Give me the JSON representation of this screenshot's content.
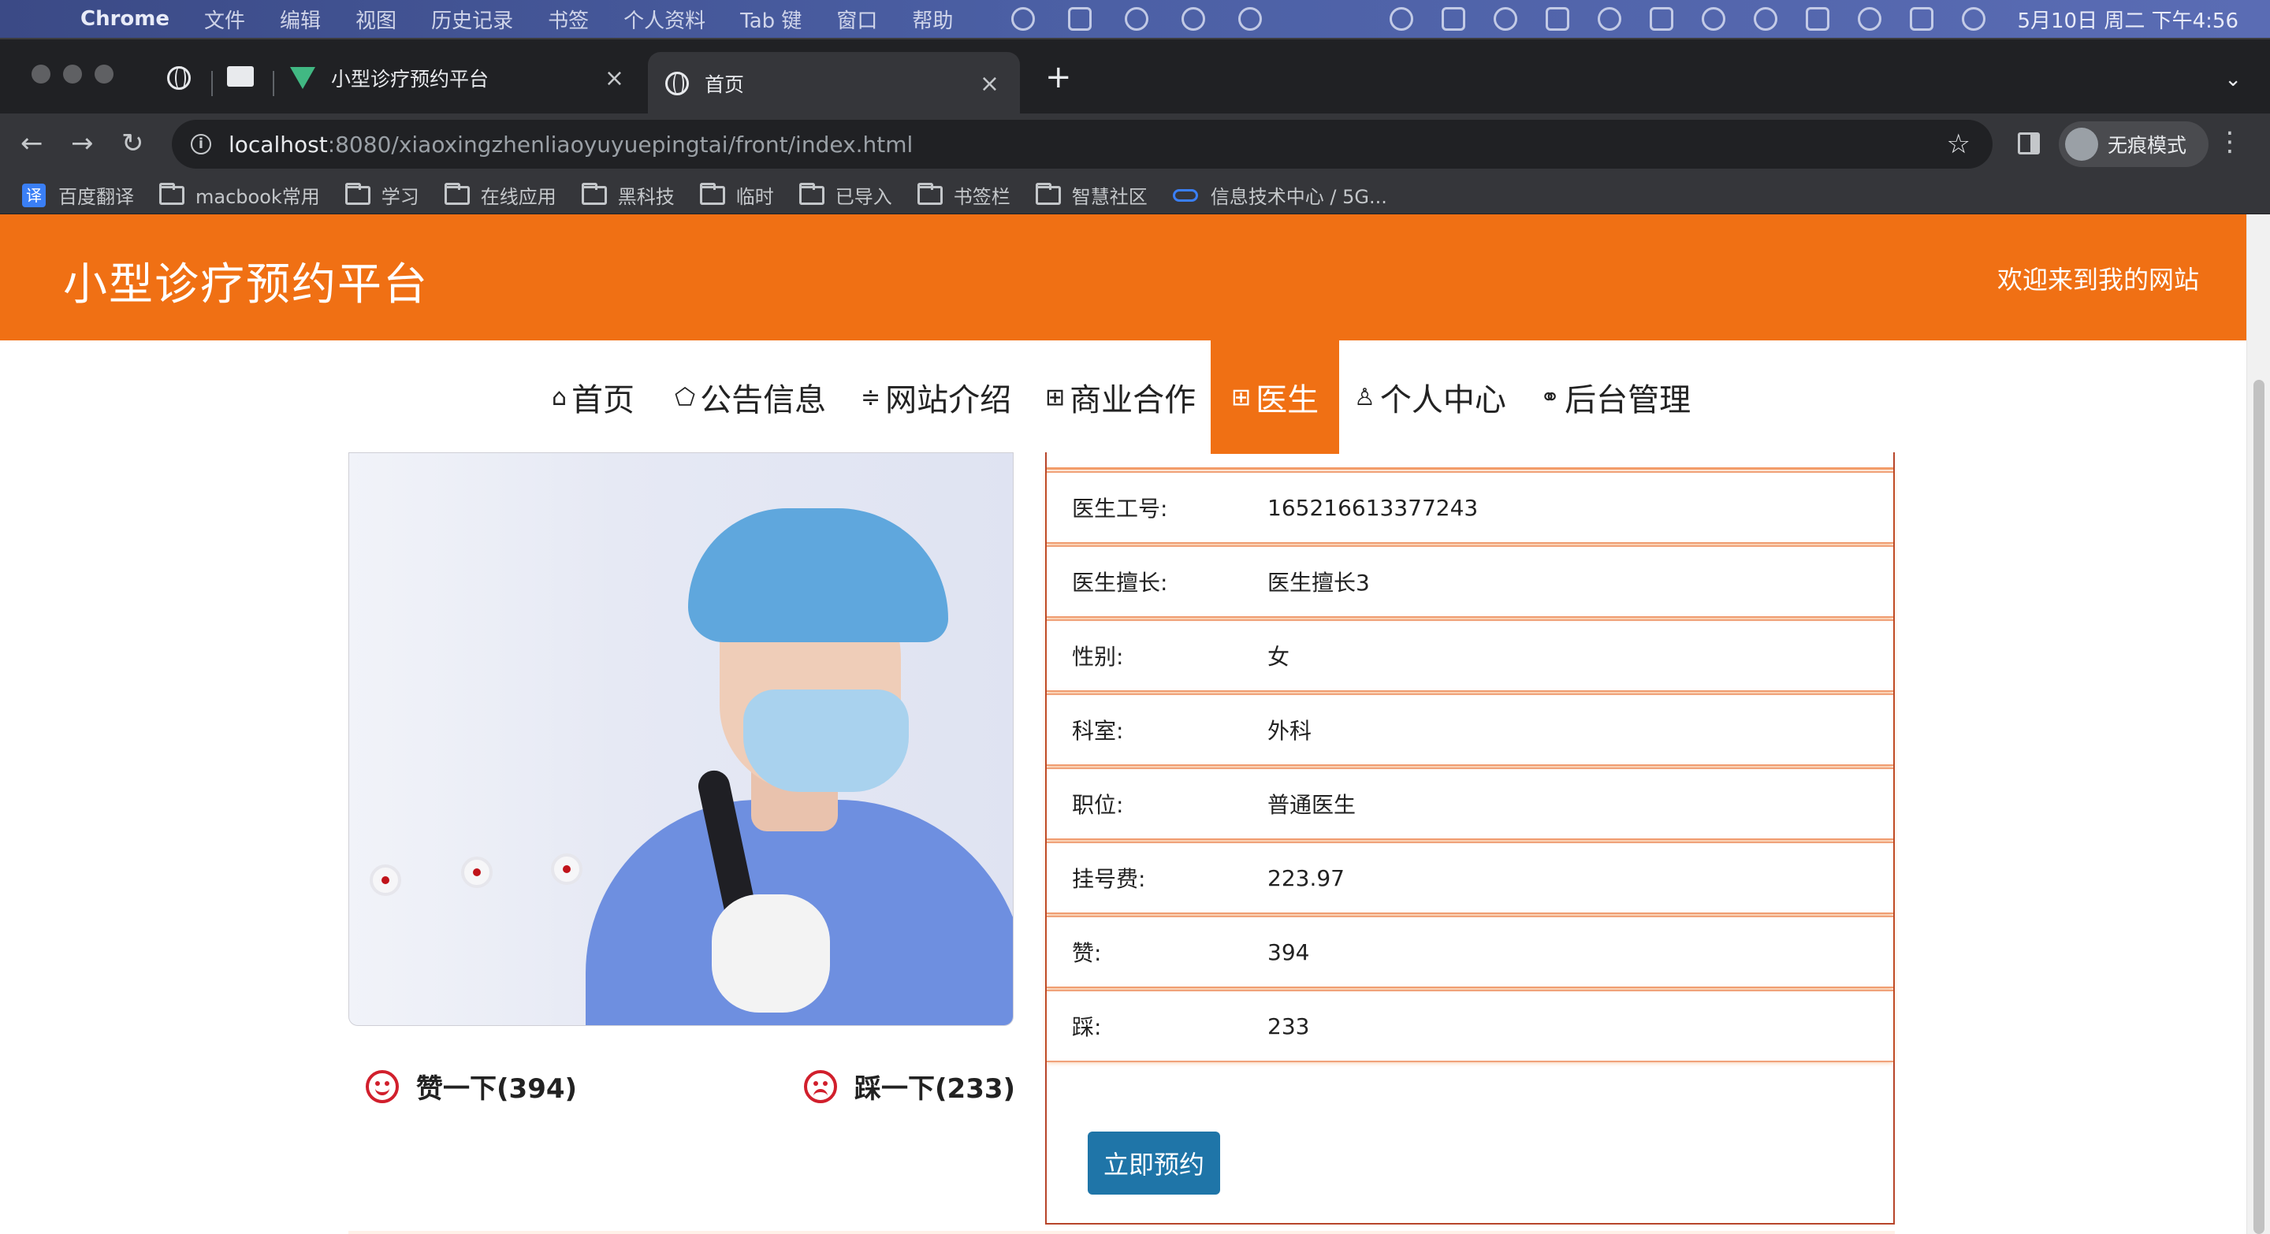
{
  "menubar": {
    "apple": "",
    "items": [
      "Chrome",
      "文件",
      "编辑",
      "视图",
      "历史记录",
      "书签",
      "个人资料",
      "Tab 键",
      "窗口",
      "帮助"
    ],
    "clock": "5月10日 周二 下午4:56"
  },
  "browser": {
    "tabs": [
      {
        "title": "小型诊疗预约平台",
        "icon": "vue-icon"
      },
      {
        "title": "首页",
        "icon": "globe-icon"
      }
    ],
    "close_glyph": "×",
    "new_tab_glyph": "+",
    "url_host": "localhost",
    "url_rest": ":8080/xiaoxingzhenliaoyuyuepingtai/front/index.html",
    "profile_label": "无痕模式",
    "bookmarks": [
      "百度翻译",
      "macbook常用",
      "学习",
      "在线应用",
      "黑科技",
      "临时",
      "已导入",
      "书签栏",
      "智慧社区",
      "信息技术中心 / 5G..."
    ],
    "translate_badge": "译"
  },
  "site": {
    "title": "小型诊疗预约平台",
    "welcome": "欢迎来到我的网站",
    "nav": [
      {
        "label": "首页",
        "icon": "⌂"
      },
      {
        "label": "公告信息",
        "icon": "⬠"
      },
      {
        "label": "网站介绍",
        "icon": "≑"
      },
      {
        "label": "商业合作",
        "icon": "⊞"
      },
      {
        "label": "医生",
        "icon": "⊞"
      },
      {
        "label": "个人中心",
        "icon": "♙"
      },
      {
        "label": "后台管理",
        "icon": "⚭"
      }
    ],
    "active_nav": "医生",
    "accent_color": "#f07014"
  },
  "doctor": {
    "rows": [
      {
        "label": "医生工号:",
        "value": "165216613377243"
      },
      {
        "label": "医生擅长:",
        "value": "医生擅长3"
      },
      {
        "label": "性别:",
        "value": "女"
      },
      {
        "label": "科室:",
        "value": "外科"
      },
      {
        "label": "职位:",
        "value": "普通医生"
      },
      {
        "label": "挂号费:",
        "value": "223.97"
      },
      {
        "label": "赞:",
        "value": "394"
      },
      {
        "label": "踩:",
        "value": "233"
      }
    ],
    "like_label": "赞一下(394)",
    "dislike_label": "踩一下(233)",
    "book_button": "立即预约"
  }
}
